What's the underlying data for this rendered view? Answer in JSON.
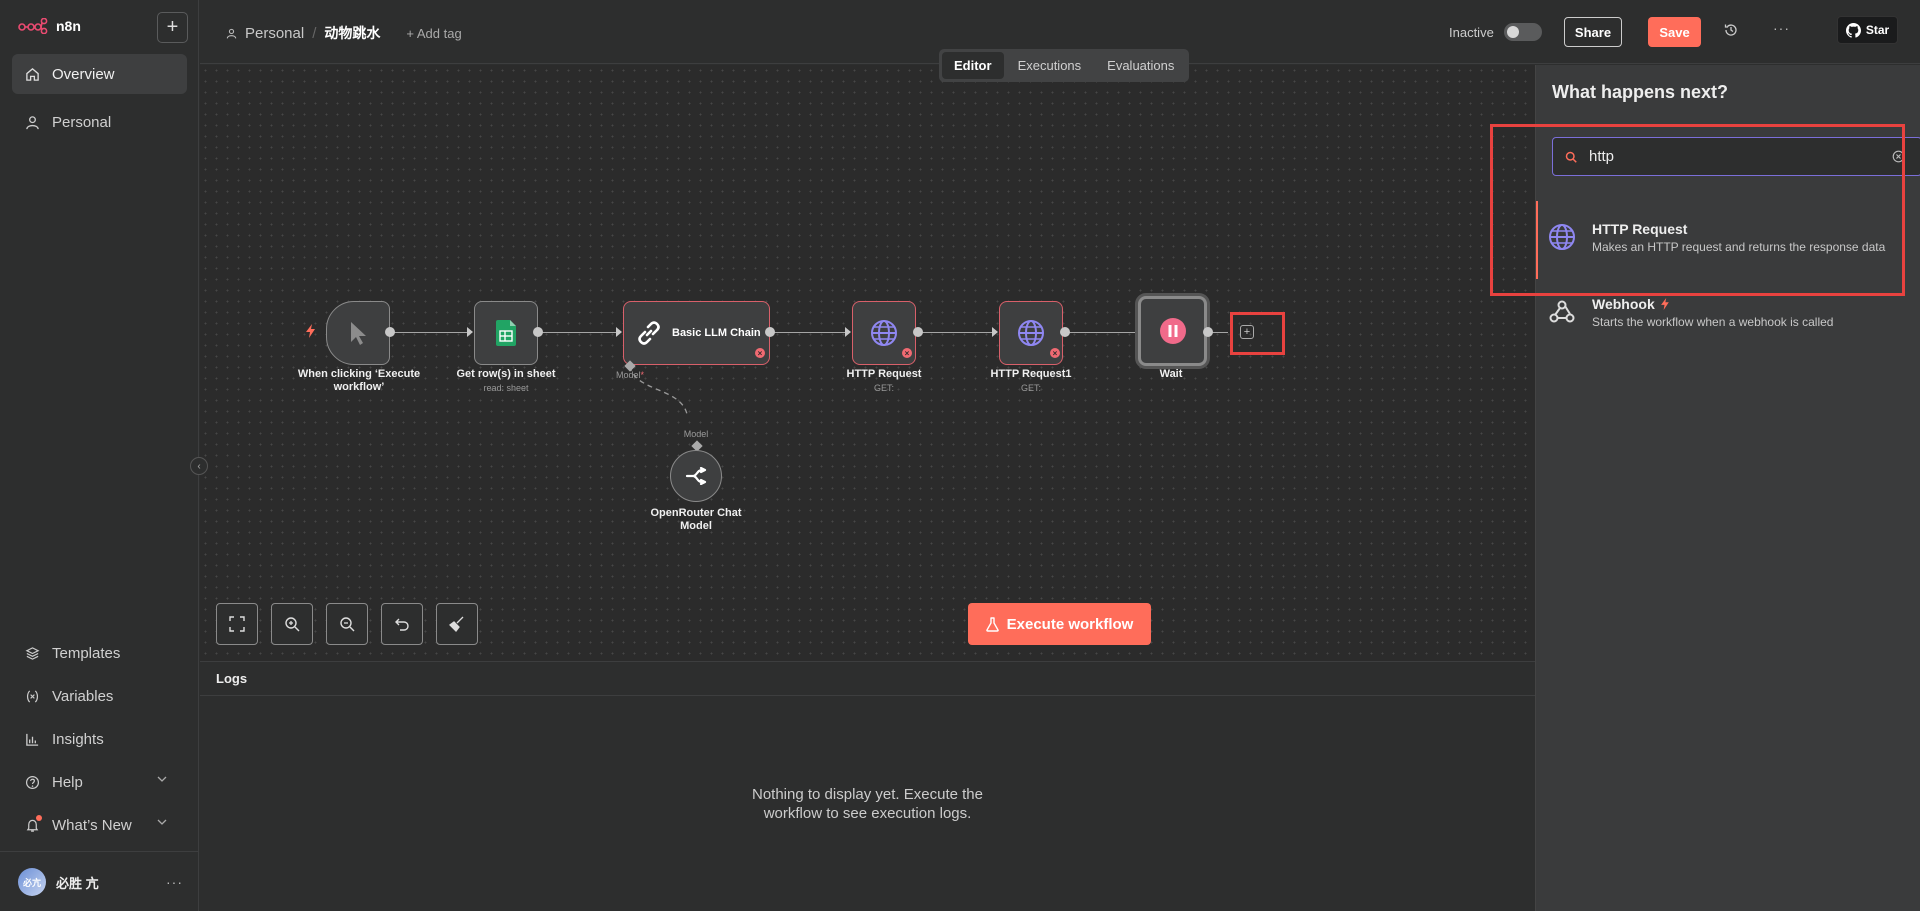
{
  "app": {
    "logo_text": "n8n",
    "new_label": "+"
  },
  "sidebar": {
    "items": [
      {
        "label": "Overview"
      },
      {
        "label": "Personal"
      }
    ],
    "bottom_items": [
      {
        "label": "Templates"
      },
      {
        "label": "Variables"
      },
      {
        "label": "Insights"
      },
      {
        "label": "Help"
      },
      {
        "label": "What’s New"
      }
    ],
    "user": {
      "avatar_text": "必亢",
      "name": "必胜 亢"
    }
  },
  "header": {
    "project": "Personal",
    "separator": "/",
    "workflow_name": "动物跳水",
    "add_tag": "+ Add tag",
    "status_label": "Inactive",
    "share_label": "Share",
    "save_label": "Save",
    "star_label": "Star"
  },
  "tabs": [
    {
      "label": "Editor"
    },
    {
      "label": "Executions"
    },
    {
      "label": "Evaluations"
    }
  ],
  "nodes": {
    "trigger": {
      "label": "When clicking ‘Execute workflow’"
    },
    "sheet": {
      "label": "Get row(s) in sheet",
      "sub": "read: sheet"
    },
    "llm": {
      "label": "Basic LLM Chain",
      "port_label": "Model",
      "port_required": "*"
    },
    "http1": {
      "label": "HTTP Request",
      "sub": "GET:"
    },
    "http2": {
      "label": "HTTP Request1",
      "sub": "GET:"
    },
    "wait": {
      "label": "Wait"
    },
    "openrouter": {
      "label": "OpenRouter Chat Model",
      "port_label": "Model"
    }
  },
  "canvas": {
    "execute_label": "Execute workflow"
  },
  "logs": {
    "title": "Logs",
    "empty_line1": "Nothing to display yet. Execute the",
    "empty_line2": "workflow to see execution logs."
  },
  "panel": {
    "title": "What happens next?",
    "search_value": "http",
    "results": [
      {
        "title": "HTTP Request",
        "desc": "Makes an HTTP request and returns the response data"
      },
      {
        "title": "Webhook",
        "desc": "Starts the workflow when a webhook is called"
      }
    ]
  },
  "colors": {
    "accent": "#ff6d5a",
    "highlight": "#e8423f",
    "error": "#f06a72",
    "search_border": "#7b6fd9"
  }
}
